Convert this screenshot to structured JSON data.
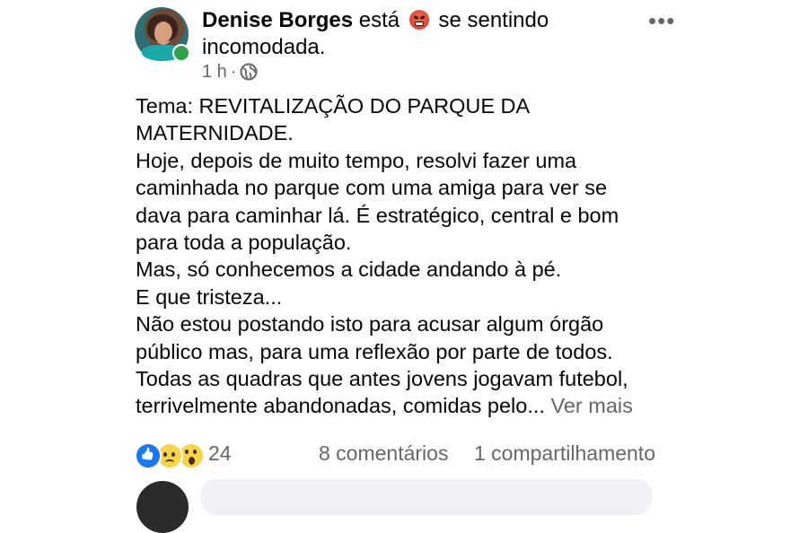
{
  "post": {
    "author": "Denise Borges",
    "status_pre": "está",
    "feeling_icon": "angry-face-icon",
    "status_post": "se sentindo",
    "feeling": "incomodada.",
    "time": "1 h",
    "separator": "·",
    "audience_icon": "globe-icon",
    "more_icon": "•••",
    "body": [
      "Tema: REVITALIZAÇÃO DO PARQUE DA",
      "MATERNIDADE.",
      "Hoje, depois de muito tempo, resolvi fazer uma",
      "caminhada no parque com uma amiga para ver se",
      "dava para caminhar lá. É estratégico, central e bom",
      "para toda a população.",
      "Mas, só conhecemos a cidade andando à pé.",
      "E que tristeza...",
      "Não estou postando isto para acusar algum órgão",
      "público mas, para uma reflexão por parte de todos.",
      "Todas as quadras que antes jovens jogavam futebol,",
      "terrivelmente abandonadas, comidas pelo..."
    ],
    "see_more": "Ver mais"
  },
  "footer": {
    "reactions": [
      "like-icon",
      "sad-icon",
      "wow-icon"
    ],
    "reaction_count": "24",
    "comments": "8 comentários",
    "shares": "1 compartilhamento"
  },
  "colors": {
    "secondary_text": "#65676b",
    "online": "#31a24c",
    "like_blue": "#1877f2"
  }
}
